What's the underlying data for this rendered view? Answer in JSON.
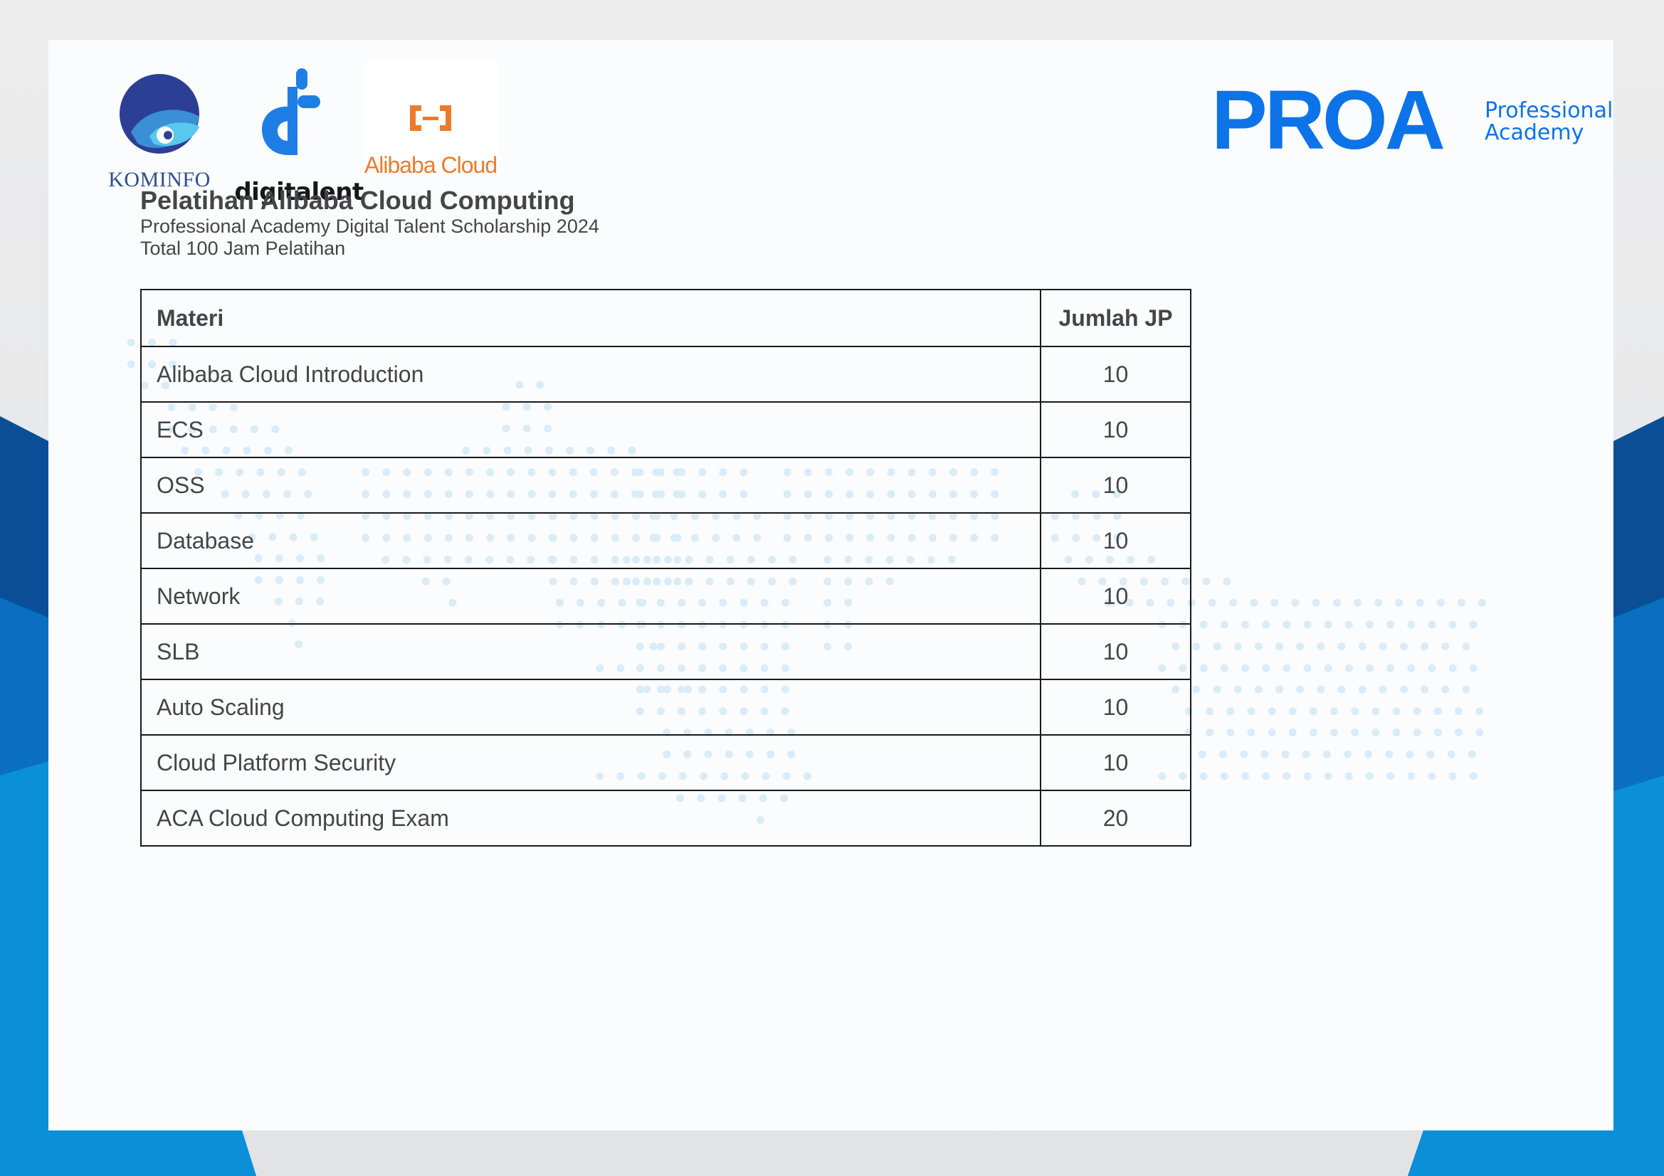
{
  "logos": {
    "kominfo": "KOMINFO",
    "digitalent": "digitalent",
    "alibaba": "Alibaba Cloud",
    "proa_word": "PROA",
    "proa_sub_line1": "Professional",
    "proa_sub_line2": "Academy"
  },
  "heading": {
    "title": "Pelatihan Alibaba Cloud Computing",
    "subtitle": "Professional Academy Digital Talent Scholarship 2024",
    "hours": "Total 100 Jam Pelatihan"
  },
  "table": {
    "headers": {
      "materi": "Materi",
      "jp": "Jumlah JP"
    },
    "rows": [
      {
        "materi": "Alibaba Cloud Introduction",
        "jp": "10"
      },
      {
        "materi": "ECS",
        "jp": "10"
      },
      {
        "materi": "OSS",
        "jp": "10"
      },
      {
        "materi": "Database",
        "jp": "10"
      },
      {
        "materi": "Network",
        "jp": "10"
      },
      {
        "materi": "SLB",
        "jp": "10"
      },
      {
        "materi": "Auto Scaling",
        "jp": "10"
      },
      {
        "materi": "Cloud Platform Security",
        "jp": "10"
      },
      {
        "materi": "ACA Cloud Computing Exam",
        "jp": "20"
      }
    ]
  },
  "colors": {
    "accent_blue": "#0d73e8",
    "band_dark": "#0a4f95",
    "band_mid": "#0a6fc0",
    "band_light": "#0b8fd9",
    "alibaba_orange": "#ec7b2d",
    "text": "#454547",
    "map_dot": "#d9ecf8"
  }
}
